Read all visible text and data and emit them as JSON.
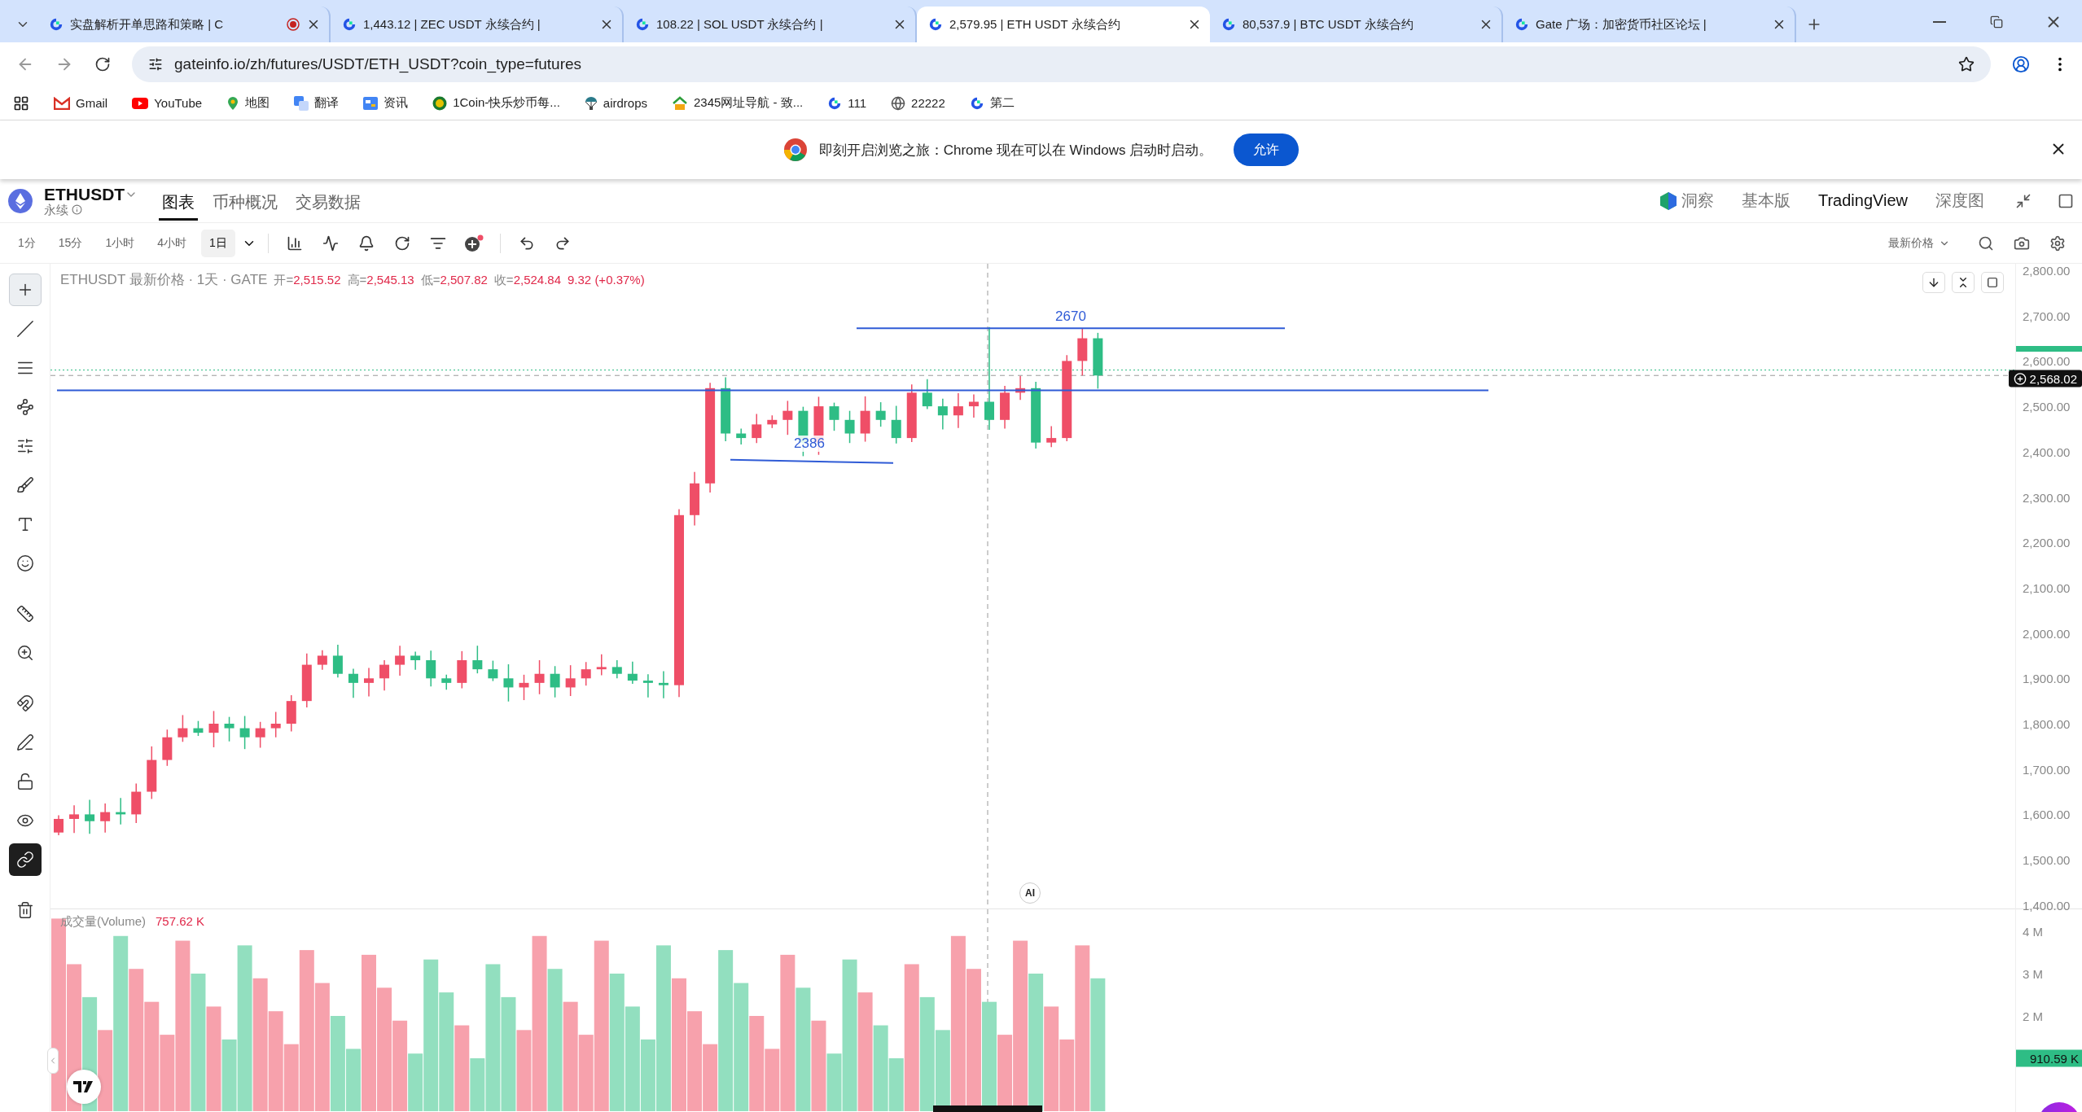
{
  "browser": {
    "tabs": [
      {
        "title": "实盘解析开单思路和策略 | C",
        "selected": false,
        "recording": true
      },
      {
        "title": "1,443.12 | ZEC USDT 永续合约 |",
        "selected": false,
        "recording": false
      },
      {
        "title": "108.22 | SOL USDT 永续合约 |",
        "selected": false,
        "recording": false
      },
      {
        "title": "2,579.95 | ETH USDT 永续合约",
        "selected": true,
        "recording": false
      },
      {
        "title": "80,537.9 | BTC USDT 永续合约",
        "selected": false,
        "recording": false
      },
      {
        "title": "Gate 广场：加密货币社区论坛 |",
        "selected": false,
        "recording": false
      }
    ],
    "address": "gateinfo.io/zh/futures/USDT/ETH_USDT?coin_type=futures",
    "bookmarks": [
      {
        "label": "Gmail",
        "kind": "gmail"
      },
      {
        "label": "YouTube",
        "kind": "youtube"
      },
      {
        "label": "地图",
        "kind": "maps"
      },
      {
        "label": "翻译",
        "kind": "translate"
      },
      {
        "label": "资讯",
        "kind": "news"
      },
      {
        "label": "1Coin-快乐炒币每...",
        "kind": "coin"
      },
      {
        "label": "airdrops",
        "kind": "parachute"
      },
      {
        "label": "2345网址导航 - 致...",
        "kind": "house"
      },
      {
        "label": "111",
        "kind": "gate"
      },
      {
        "label": "22222",
        "kind": "globe"
      },
      {
        "label": "第二",
        "kind": "gate"
      }
    ],
    "notification": {
      "text": "即刻开启浏览之旅：Chrome 现在可以在 Windows 启动时启动。",
      "button": "允许"
    }
  },
  "header": {
    "symbol": "ETHUSDT",
    "contract": "永续",
    "tabs": [
      {
        "label": "图表",
        "selected": true
      },
      {
        "label": "币种概况",
        "selected": false
      },
      {
        "label": "交易数据",
        "selected": false
      }
    ],
    "views": [
      {
        "label": "洞察",
        "kind": "insight",
        "selected": false
      },
      {
        "label": "基本版",
        "kind": "plain",
        "selected": false
      },
      {
        "label": "TradingView",
        "kind": "plain",
        "selected": true
      },
      {
        "label": "深度图",
        "kind": "plain",
        "selected": false
      }
    ]
  },
  "toolbar": {
    "intervals": [
      {
        "label": "1分",
        "selected": false
      },
      {
        "label": "15分",
        "selected": false
      },
      {
        "label": "1小时",
        "selected": false
      },
      {
        "label": "4小时",
        "selected": false
      },
      {
        "label": "1日",
        "selected": true
      }
    ],
    "price_type": "最新价格"
  },
  "tools": [
    {
      "kind": "crosshair",
      "selected": true,
      "on": false
    },
    {
      "kind": "line",
      "selected": false,
      "on": false
    },
    {
      "kind": "parallel",
      "selected": false,
      "on": false
    },
    {
      "kind": "pattern",
      "selected": false,
      "on": false
    },
    {
      "kind": "fib",
      "selected": false,
      "on": false
    },
    {
      "kind": "brush",
      "selected": false,
      "on": false
    },
    {
      "kind": "text",
      "selected": false,
      "on": false
    },
    {
      "kind": "emoji",
      "selected": false,
      "on": false
    },
    {
      "kind": "ruler",
      "selected": false,
      "on": false
    },
    {
      "kind": "zoom",
      "selected": false,
      "on": false
    },
    {
      "kind": "magnet",
      "selected": false,
      "on": false
    },
    {
      "kind": "drawlock",
      "selected": false,
      "on": false
    },
    {
      "kind": "lock",
      "selected": false,
      "on": false
    },
    {
      "kind": "eye",
      "selected": false,
      "on": false
    },
    {
      "kind": "link",
      "selected": false,
      "on": true
    },
    {
      "kind": "trash",
      "selected": false,
      "on": false
    }
  ],
  "chart": {
    "legend": {
      "title": "ETHUSDT 最新价格 · 1天 · GATE",
      "fields": [
        {
          "label": "开=",
          "value": "2,515.52"
        },
        {
          "label": "高=",
          "value": "2,545.13"
        },
        {
          "label": "低=",
          "value": "2,507.82"
        },
        {
          "label": "收=",
          "value": "2,524.84"
        }
      ],
      "change": "9.32 (+0.37%)"
    },
    "price_axis": [
      "2,800.00",
      "2,700.00",
      "2,600.00",
      "2,500.00",
      "2,400.00",
      "2,300.00",
      "2,200.00",
      "2,100.00",
      "2,000.00",
      "1,900.00",
      "1,800.00",
      "1,700.00",
      "1,600.00",
      "1,500.00",
      "1,400.00"
    ],
    "line_labels": [
      "2670",
      "2386"
    ],
    "last_price": "2,568.02",
    "ai_badge": "AI",
    "volume": {
      "title": "成交量(Volume)",
      "value": "757.62 K",
      "axis": [
        "4 M",
        "3 M",
        "2 M"
      ],
      "last": "910.59 K"
    }
  }
}
